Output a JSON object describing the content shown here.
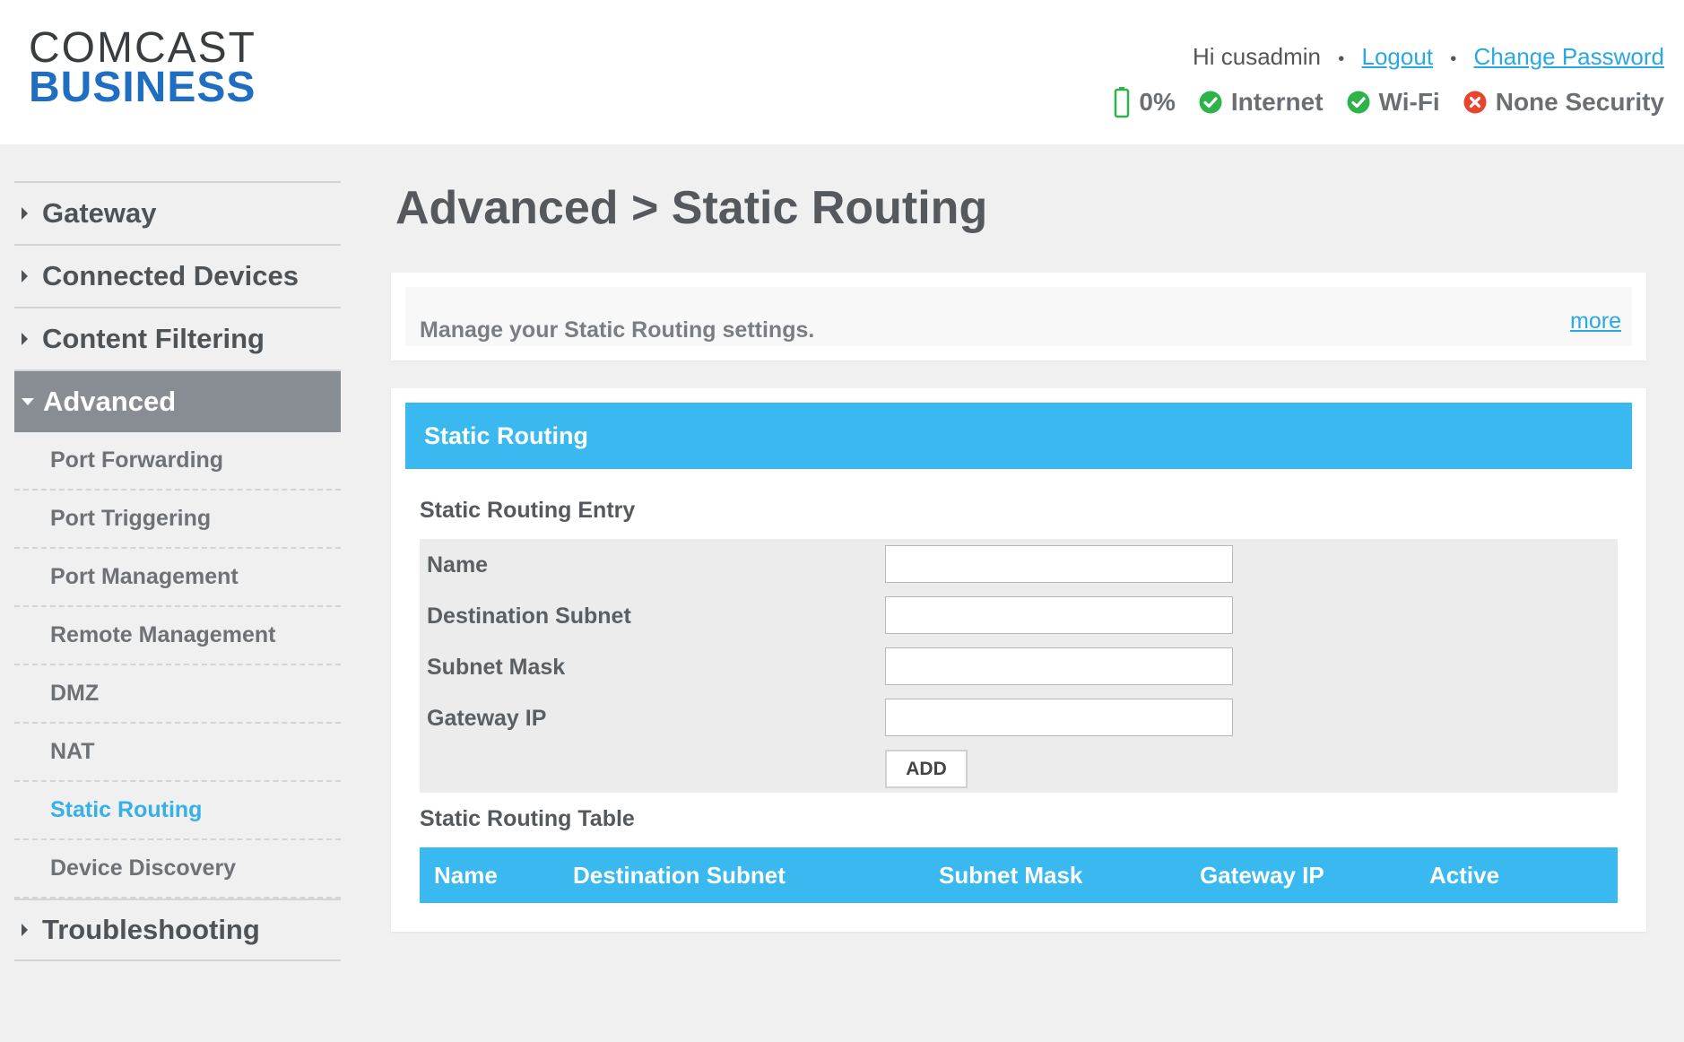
{
  "logo": {
    "line1": "COMCAST",
    "line2": "BUSINESS"
  },
  "user": {
    "greeting": "Hi cusadmin",
    "separator": "•",
    "logout": "Logout",
    "change_password": "Change Password"
  },
  "status": {
    "battery": "0%",
    "internet": "Internet",
    "wifi": "Wi-Fi",
    "security": "None Security",
    "ok_color": "#2db34a",
    "error_color": "#e9442f"
  },
  "sidebar": {
    "gateway": "Gateway",
    "connected_devices": "Connected Devices",
    "content_filtering": "Content Filtering",
    "advanced": "Advanced",
    "sub_items": [
      "Port Forwarding",
      "Port Triggering",
      "Port Management",
      "Remote Management",
      "DMZ",
      "NAT",
      "Static Routing",
      "Device Discovery"
    ],
    "troubleshooting": "Troubleshooting"
  },
  "page": {
    "title": "Advanced > Static Routing",
    "description": "Manage your Static Routing settings.",
    "more": "more"
  },
  "static_routing": {
    "section_title": "Static Routing",
    "entry_title": "Static Routing Entry",
    "fields": {
      "name": {
        "label": "Name",
        "value": ""
      },
      "destination_subnet": {
        "label": "Destination Subnet",
        "value": ""
      },
      "subnet_mask": {
        "label": "Subnet Mask",
        "value": ""
      },
      "gateway_ip": {
        "label": "Gateway IP",
        "value": ""
      }
    },
    "add_button": "ADD",
    "table_title": "Static Routing Table",
    "table_columns": [
      "Name",
      "Destination Subnet",
      "Subnet Mask",
      "Gateway IP",
      "Active"
    ]
  },
  "colors": {
    "accent": "#3ab9f0",
    "link": "#2aa8e3",
    "nav_active": "#878d92"
  }
}
